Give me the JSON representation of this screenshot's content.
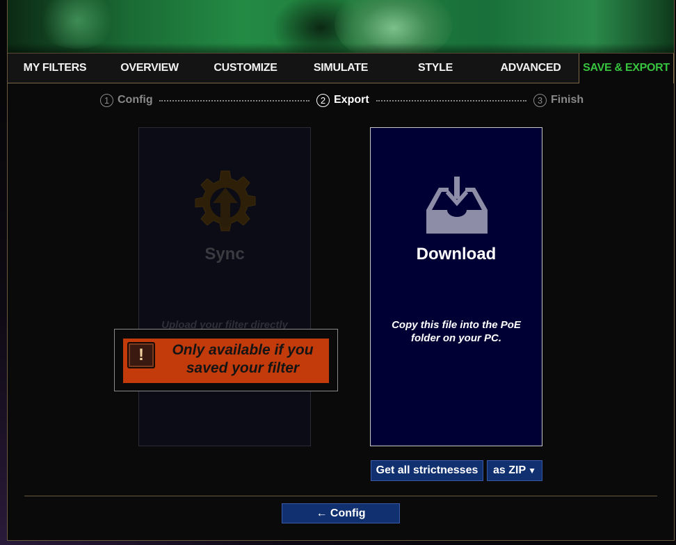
{
  "tabs": [
    {
      "label": "MY FILTERS"
    },
    {
      "label": "OVERVIEW"
    },
    {
      "label": "CUSTOMIZE"
    },
    {
      "label": "SIMULATE"
    },
    {
      "label": "STYLE"
    },
    {
      "label": "ADVANCED"
    },
    {
      "label": "SAVE & EXPORT"
    }
  ],
  "steps": [
    {
      "num": "1",
      "label": "Config"
    },
    {
      "num": "2",
      "label": "Export"
    },
    {
      "num": "3",
      "label": "Finish"
    }
  ],
  "sync": {
    "title": "Sync",
    "desc": "Upload your filter directly",
    "icon": "gear-upload-icon"
  },
  "download": {
    "title": "Download",
    "desc": "Copy this file into the PoE folder on your PC.",
    "icon": "inbox-download-icon"
  },
  "warning": {
    "badge": "!",
    "message": "Only available if you saved your filter"
  },
  "strictness_button": "Get all strictnesses",
  "format_select": {
    "value": "as ZIP"
  },
  "back_button": "← Config",
  "colors": {
    "active_tab": "#37c43f",
    "download_bg": "#000034",
    "warning_bg": "#c33b0a",
    "button_bg": "#113070"
  }
}
